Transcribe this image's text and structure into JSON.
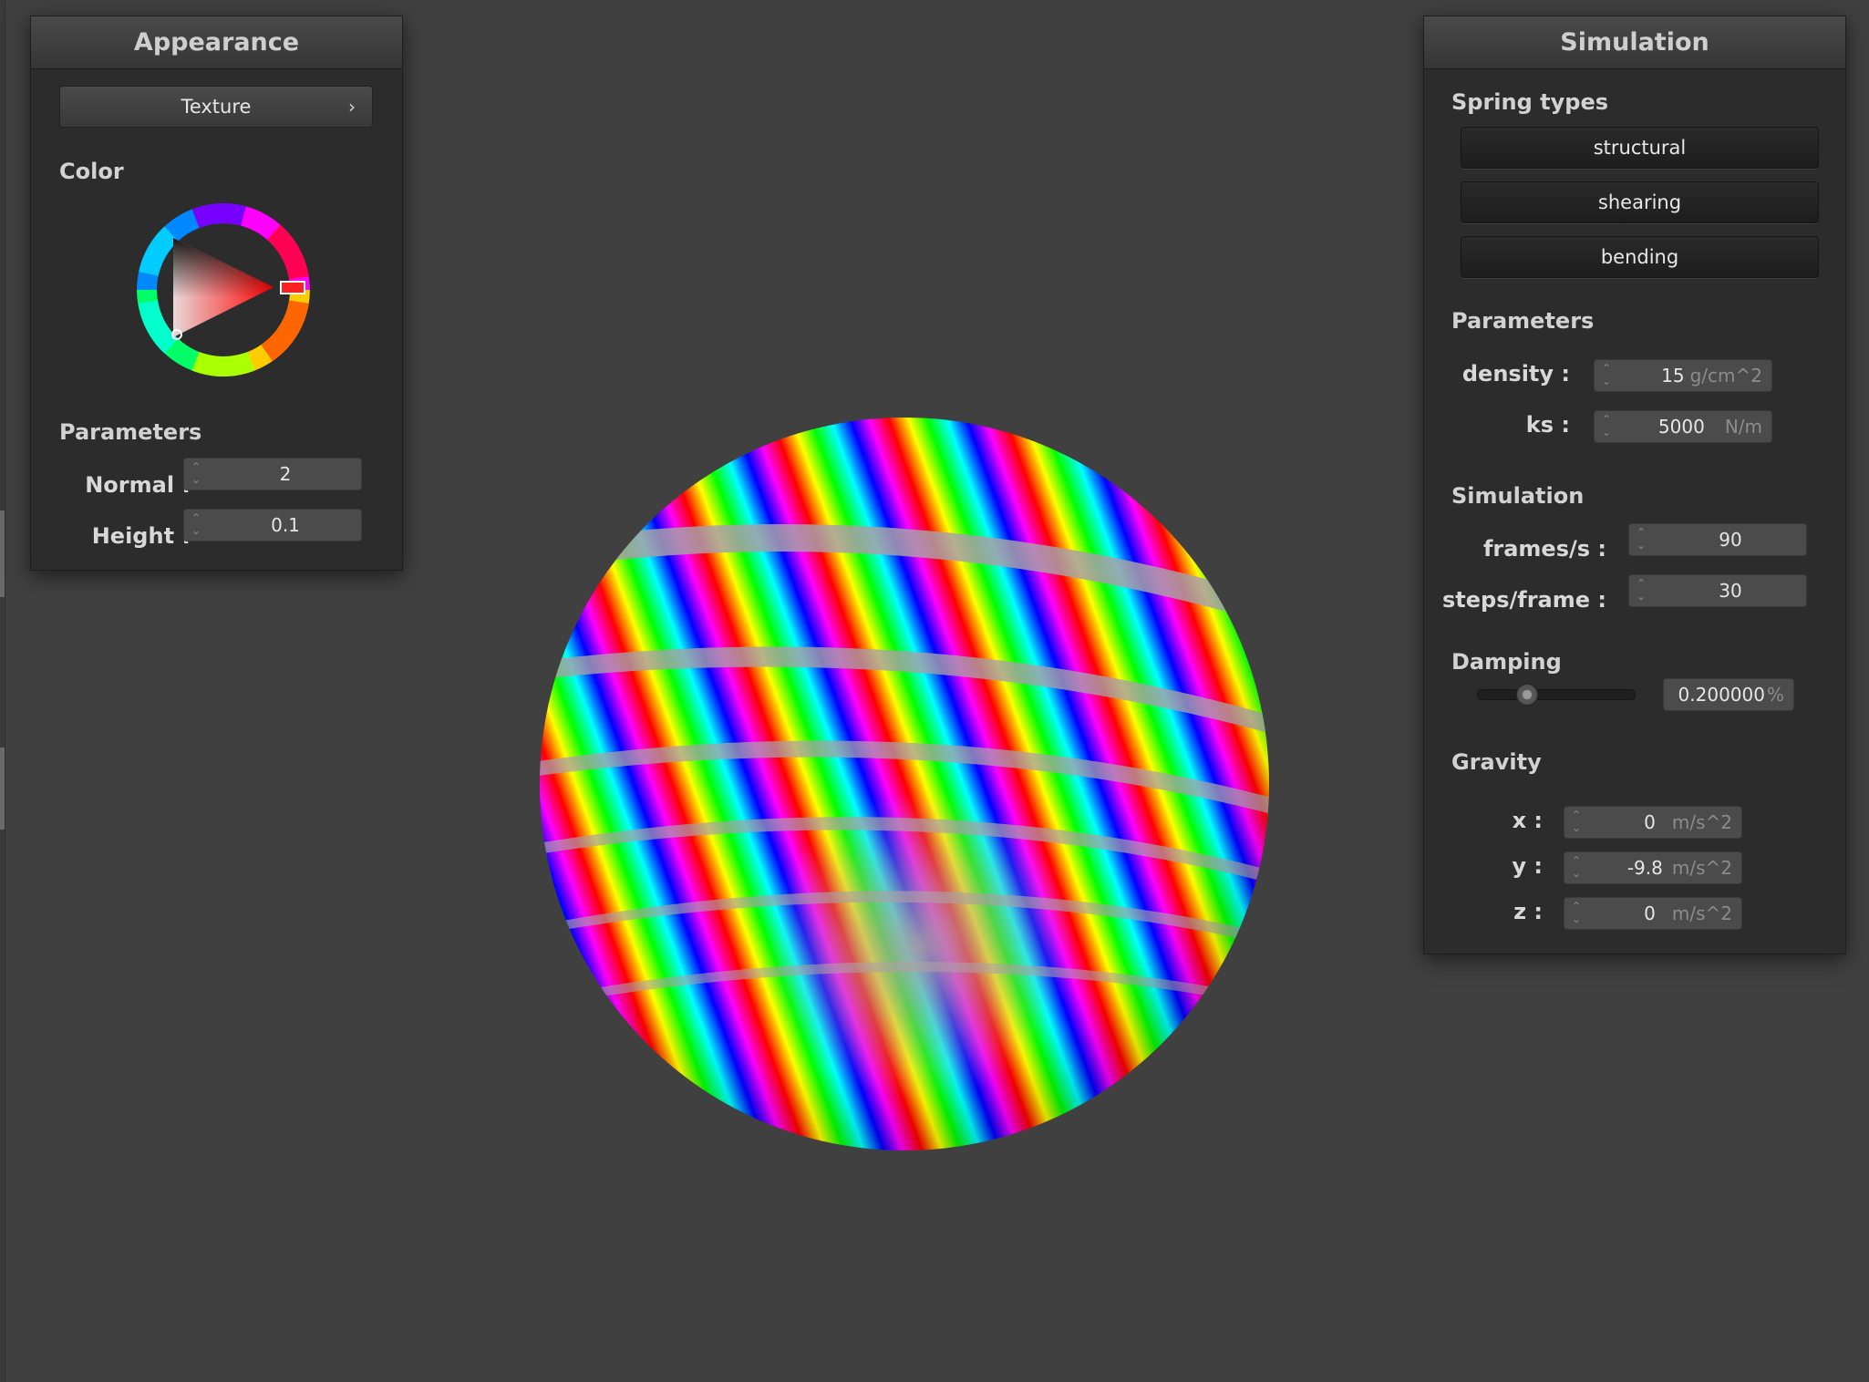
{
  "appearance_panel": {
    "title": "Appearance",
    "texture_button": "Texture",
    "color_label": "Color",
    "parameters_label": "Parameters",
    "normal_label": "Normal :",
    "normal_value": "2",
    "height_label": "Height :",
    "height_value": "0.1",
    "selected_color": "#ff0000"
  },
  "simulation_panel": {
    "title": "Simulation",
    "spring_types_label": "Spring types",
    "spring_buttons": [
      "structural",
      "shearing",
      "bending"
    ],
    "parameters_label": "Parameters",
    "density_label": "density :",
    "density_value": "15",
    "density_unit": "g/cm^2",
    "ks_label": "ks :",
    "ks_value": "5000",
    "ks_unit": "N/m",
    "simulation_label": "Simulation",
    "fps_label": "frames/s :",
    "fps_value": "90",
    "steps_label": "steps/frame :",
    "steps_value": "30",
    "damping_label": "Damping",
    "damping_value": "0.200000",
    "damping_unit": "%",
    "damping_slider_fraction": 0.2,
    "gravity_label": "Gravity",
    "gx_label": "x :",
    "gx_value": "0",
    "gy_label": "y :",
    "gy_value": "-9.8",
    "gz_label": "z :",
    "gz_value": "0",
    "gravity_unit": "m/s^2"
  },
  "icons": {
    "spinner": "up-down-chevron-icon",
    "submenu": "chevron-right-icon"
  }
}
